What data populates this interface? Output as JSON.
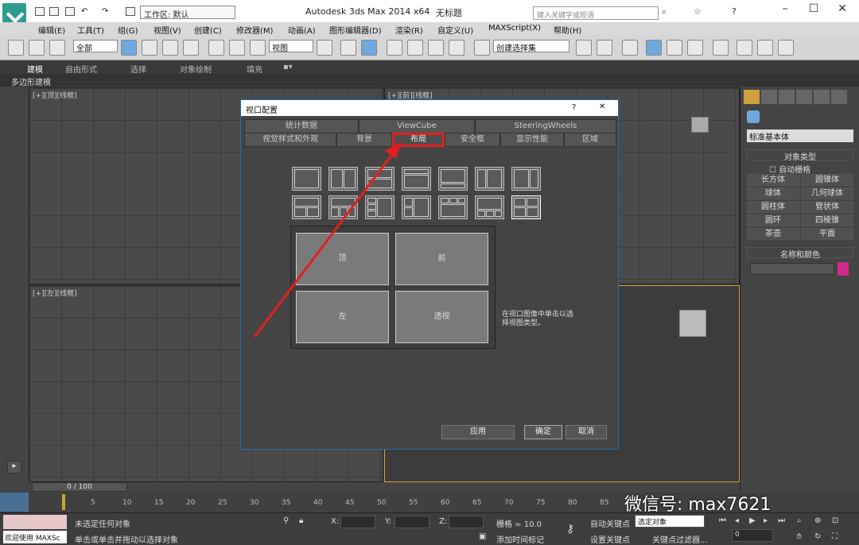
{
  "title": "Autodesk 3ds Max  2014 x64",
  "subtitle": "无标题",
  "workspace": "工作区: 默认",
  "search_placeholder": "键入关键字或短语",
  "menus": [
    "编辑(E)",
    "工具(T)",
    "组(G)",
    "视图(V)",
    "创建(C)",
    "修改器(M)",
    "动画(A)",
    "图形编辑器(D)",
    "渲染(R)",
    "自定义(U)",
    "MAXScript(X)",
    "帮助(H)"
  ],
  "toolbar": {
    "selection_filter": "全部",
    "view_dropdown": "视图",
    "named_selection": "创建选择集"
  },
  "ribbon_tabs": [
    "建模",
    "自由形式",
    "选择",
    "对象绘制",
    "填充"
  ],
  "ribbon_sub": "多边形建模",
  "viewports": {
    "top": "[+][顶][线框]",
    "front": "[+][前][线框]",
    "left": "[+][左][线框]"
  },
  "right_panel": {
    "dropdown": "标准基本体",
    "rollout1": "对象类型",
    "autogrid": "自动栅格",
    "buttons": [
      "长方体",
      "圆锥体",
      "球体",
      "几何球体",
      "圆柱体",
      "管状体",
      "圆环",
      "四棱锥",
      "茶壶",
      "平面"
    ],
    "rollout2": "名称和颜色",
    "color": "#d02a8a"
  },
  "dialog": {
    "title": "视口配置",
    "help": "?",
    "close": "✕",
    "tabs_row1": [
      "统计数据",
      "ViewCube",
      "SteeringWheels"
    ],
    "tabs_row2": [
      "视觉样式和外观",
      "背景",
      "布局",
      "安全框",
      "显示性能",
      "区域"
    ],
    "panes": [
      "顶",
      "前",
      "左",
      "透视"
    ],
    "hint": "在视口图像中单击以选择视图类型。",
    "buttons": {
      "apply": "应用",
      "ok": "确定",
      "cancel": "取消"
    }
  },
  "timeline": {
    "counter": "0 / 100",
    "ticks": [
      "5",
      "10",
      "15",
      "20",
      "25",
      "30",
      "35",
      "40",
      "45",
      "50",
      "55",
      "60",
      "65",
      "70",
      "75",
      "80",
      "85"
    ]
  },
  "status": {
    "maxscript": "欢迎使用 MAXSc",
    "line1": "未选定任何对象",
    "line2": "单击或单击并拖动以选择对象",
    "x": "X:",
    "y": "Y:",
    "z": "Z:",
    "grid": "栅格 = 10.0",
    "add_tag": "添加时间标记",
    "autokey": "自动关键点",
    "selected": "选定对象",
    "setkey": "设置关键点",
    "filter": "关键点过滤器...",
    "frame": "0"
  },
  "watermark": "微信号: max7621",
  "highlight_color": "#e02020"
}
